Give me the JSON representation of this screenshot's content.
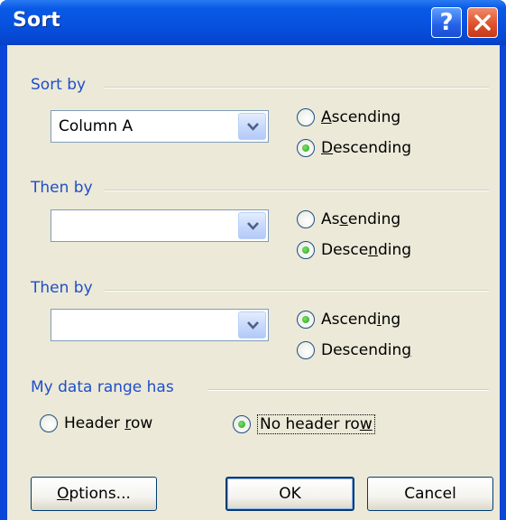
{
  "dialog": {
    "title": "Sort",
    "help_glyph": "?",
    "close_glyph": "✕"
  },
  "sort_by": {
    "label": "Sort by",
    "column": "Column A",
    "ascending": {
      "label": "Ascending",
      "selected": false
    },
    "descending": {
      "label": "Descending",
      "selected": true
    }
  },
  "then_by_1": {
    "label": "Then by",
    "column": "",
    "ascending": {
      "label": "Ascending",
      "selected": false
    },
    "descending": {
      "label": "Descending",
      "selected": true
    }
  },
  "then_by_2": {
    "label": "Then by",
    "column": "",
    "ascending": {
      "label": "Ascending",
      "selected": true
    },
    "descending": {
      "label": "Descending",
      "selected": false
    }
  },
  "data_range": {
    "label": "My data range has",
    "header_row": {
      "label": "Header row",
      "selected": false
    },
    "no_header_row": {
      "label": "No header row",
      "selected": true
    }
  },
  "buttons": {
    "options": "Options...",
    "ok": "OK",
    "cancel": "Cancel"
  },
  "icons": [
    "help-icon",
    "close-icon",
    "chevron-down-icon",
    "radio-icon"
  ],
  "colors": {
    "titlebar": "#0753e0",
    "client_background": "#ece9d8",
    "group_label": "#1f4fc9",
    "radio_selected": "#23a31c"
  }
}
